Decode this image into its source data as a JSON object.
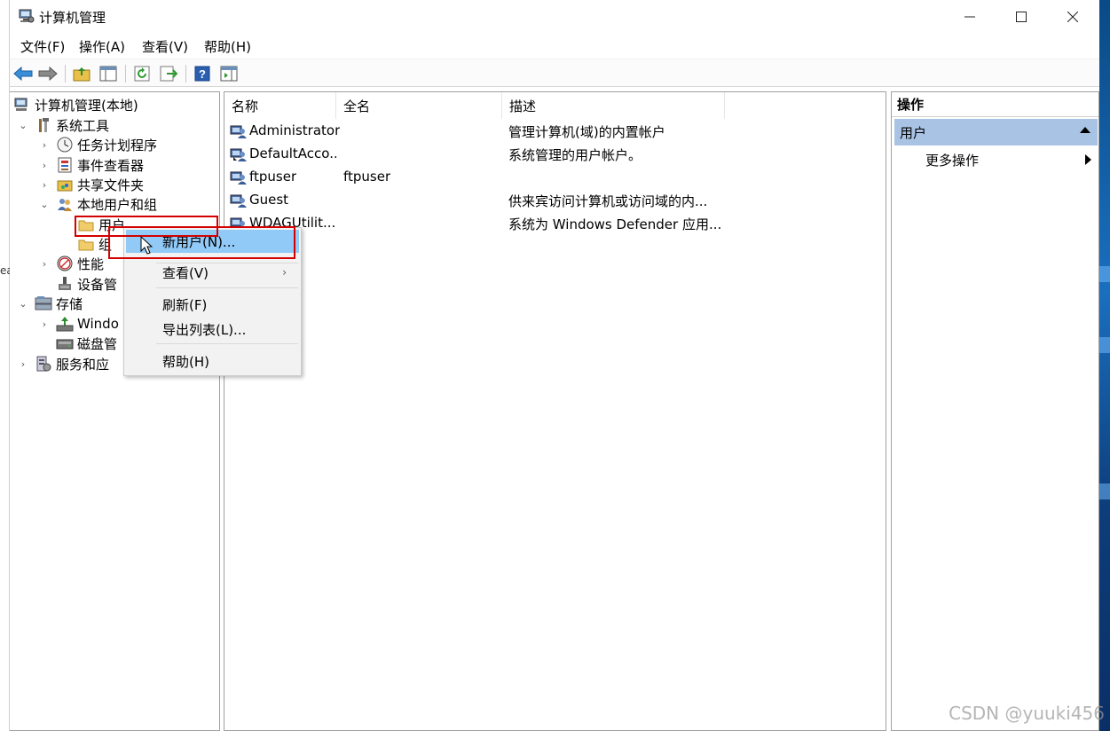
{
  "window": {
    "title": "计算机管理",
    "menu": [
      "文件(F)",
      "操作(A)",
      "查看(V)",
      "帮助(H)"
    ]
  },
  "tree": {
    "root": "计算机管理(本地)",
    "system_tools": "系统工具",
    "task_scheduler": "任务计划程序",
    "event_viewer": "事件查看器",
    "shared_folders": "共享文件夹",
    "local_users_groups": "本地用户和组",
    "users": "用户",
    "groups": "组",
    "performance": "性能",
    "device_manager": "设备管",
    "storage": "存储",
    "windows_backup": "Windo",
    "disk_management": "磁盘管",
    "services_apps": "服务和应"
  },
  "list": {
    "columns": [
      "名称",
      "全名",
      "描述"
    ],
    "rows": [
      {
        "name": "Administrator",
        "fullname": "",
        "description": "管理计算机(域)的内置帐户"
      },
      {
        "name": "DefaultAcco...",
        "fullname": "",
        "description": "系统管理的用户帐户。"
      },
      {
        "name": "ftpuser",
        "fullname": "ftpuser",
        "description": ""
      },
      {
        "name": "Guest",
        "fullname": "",
        "description": "供来宾访问计算机或访问域的内..."
      },
      {
        "name": "WDAGUtilit...",
        "fullname": "",
        "description": "系统为 Windows Defender 应用..."
      }
    ]
  },
  "actions": {
    "title": "操作",
    "section": "用户",
    "more": "更多操作"
  },
  "context_menu": {
    "new_user": "新用户(N)...",
    "view": "查看(V)",
    "refresh": "刷新(F)",
    "export": "导出列表(L)...",
    "help": "帮助(H)"
  },
  "left_edge_text": "ea",
  "watermark": "CSDN @yuuki456"
}
